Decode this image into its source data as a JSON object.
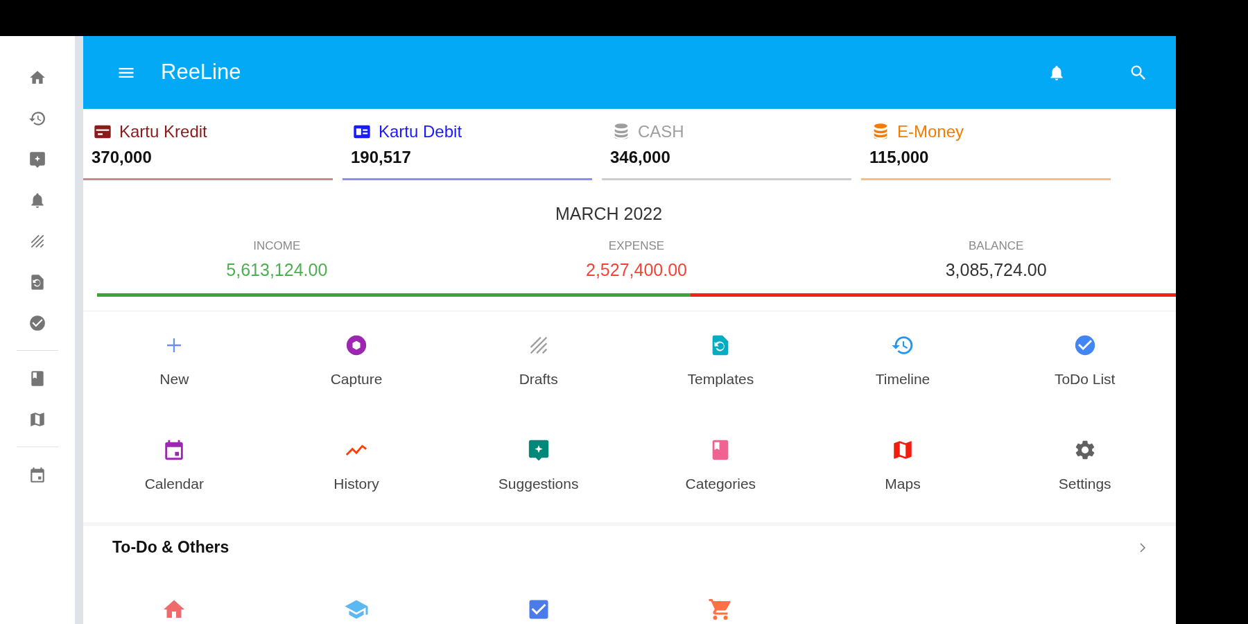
{
  "app_bar": {
    "title": "ReeLine"
  },
  "accounts": [
    {
      "name": "Kartu Kredit",
      "amount": "370,000",
      "color": "#8b1a1a",
      "kind": "credit"
    },
    {
      "name": "Kartu Debit",
      "amount": "190,517",
      "color": "#1a1aff",
      "kind": "debit"
    },
    {
      "name": "CASH",
      "amount": "346,000",
      "color": "#9e9e9e",
      "kind": "cash"
    },
    {
      "name": "E-Money",
      "amount": "115,000",
      "color": "#f57c00",
      "kind": "emoney"
    }
  ],
  "summary": {
    "month": "MARCH 2022",
    "columns": [
      {
        "label": "INCOME",
        "value": "5,613,124.00",
        "kind": "income"
      },
      {
        "label": "EXPENSE",
        "value": "2,527,400.00",
        "kind": "expense"
      },
      {
        "label": "BALANCE",
        "value": "3,085,724.00",
        "kind": "balance"
      }
    ],
    "income_bar": {
      "level": 0.55
    }
  },
  "shortcuts": [
    {
      "label": "New",
      "kind": "new",
      "color": "#6c8cf5"
    },
    {
      "label": "Capture",
      "kind": "capture",
      "color": "#9c27b0"
    },
    {
      "label": "Drafts",
      "kind": "drafts",
      "color": "#9e9e9e"
    },
    {
      "label": "Templates",
      "kind": "templates",
      "color": "#00acc1"
    },
    {
      "label": "Timeline",
      "kind": "timeline",
      "color": "#2196f3"
    },
    {
      "label": "ToDo List",
      "kind": "todo",
      "color": "#4285f4"
    },
    {
      "label": "Calendar",
      "kind": "calendar",
      "color": "#9c27b0"
    },
    {
      "label": "History",
      "kind": "history",
      "color": "#ff3d00"
    },
    {
      "label": "Suggestions",
      "kind": "suggestions",
      "color": "#00897b"
    },
    {
      "label": "Categories",
      "kind": "categories",
      "color": "#f06292"
    },
    {
      "label": "Maps",
      "kind": "maps",
      "color": "#f21d0f"
    },
    {
      "label": "Settings",
      "kind": "settings",
      "color": "#616161"
    }
  ],
  "todo_section": {
    "title": "To-Do & Others",
    "items": [
      {
        "kind": "home",
        "color": "#ef6b6b"
      },
      {
        "kind": "school",
        "color": "#5bb8f0"
      },
      {
        "kind": "checkbox",
        "color": "#4a7bea"
      },
      {
        "kind": "cart",
        "color": "#ff7043"
      }
    ]
  }
}
